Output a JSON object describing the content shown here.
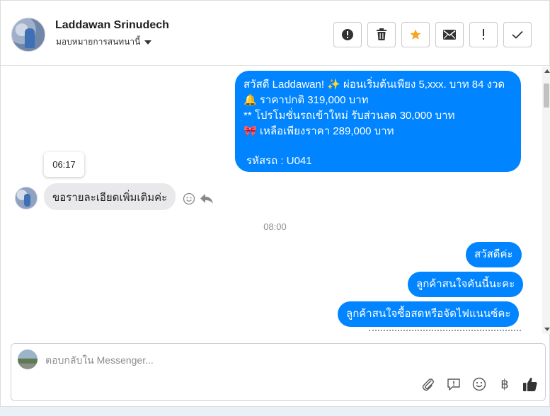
{
  "header": {
    "contact_name": "Laddawan Srinudech",
    "assign_label": "มอบหมายการสนทนานี้",
    "actions": [
      {
        "name": "spam-button",
        "icon": "alert-circle-icon"
      },
      {
        "name": "delete-button",
        "icon": "trash-icon"
      },
      {
        "name": "star-button",
        "icon": "star-icon"
      },
      {
        "name": "mark-unread-button",
        "icon": "envelope-icon"
      },
      {
        "name": "follow-up-button",
        "icon": "exclamation-icon"
      },
      {
        "name": "mark-done-button",
        "icon": "check-icon"
      }
    ]
  },
  "messages": {
    "outgoing_promo": {
      "line1": "สวัสดี Laddawan! ✨  ผ่อนเริ่มต้นเพียง 5,xxx. บาท 84 งวด",
      "line2": "🔔 ราคาปกติ 319,000 บาท",
      "line3": "** โปรโมชั่นรถเข้าใหม่ รับส่วนลด 30,000 บาท",
      "line4": "🎀  เหลือเพียงราคา 289,000 บาท",
      "line5": "รหัสรถ : U041"
    },
    "tooltip_time": "06:17",
    "incoming_1": "ขอรายละเอียดเพิ่มเติมค่ะ",
    "time_separator": "08:00",
    "outgoing_1": "สวัสดีค่ะ",
    "outgoing_2": "ลูกค้าสนใจคันนี้นะคะ",
    "outgoing_3": "ลูกค้าสนใจซื้อสดหรือจัดไฟแนนซ์คะ"
  },
  "composer": {
    "placeholder": "ตอบกลับใน Messenger...",
    "tools": [
      "attachment-icon",
      "saved-reply-icon",
      "emoji-icon",
      "baht-icon",
      "like-icon"
    ],
    "currency_symbol": "฿"
  },
  "colors": {
    "outgoing_bubble": "#0084ff",
    "incoming_bubble": "#e9e9eb",
    "star_accent": "#f5a623"
  }
}
